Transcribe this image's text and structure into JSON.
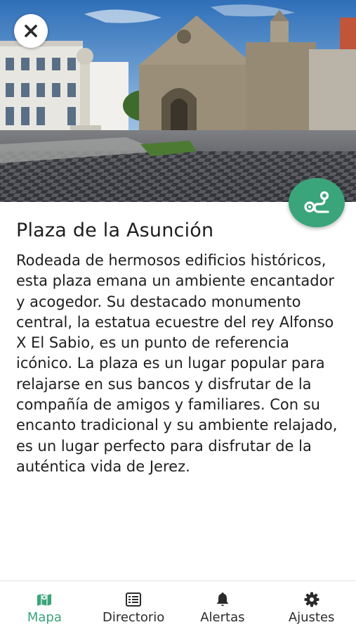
{
  "place": {
    "title": "Plaza de la Asunción",
    "description": "Rodeada de hermosos edificios históricos, esta plaza emana un ambiente encantador y acogedor. Su destacado monumento central, la estatua ecuestre del rey Alfonso X El Sabio, es un punto de referencia icónico. La plaza es un lugar popular para relajarse en sus bancos y disfrutar de la compañía de amigos y familiares. Con su encanto tradicional y su ambiente relajado, es un lugar perfecto para disfrutar de la auténtica vida de Jerez."
  },
  "buttons": {
    "close_icon": "close-icon",
    "route_icon": "route-icon"
  },
  "nav": {
    "items": [
      {
        "label": "Mapa",
        "icon": "map-icon",
        "active": true
      },
      {
        "label": "Directorio",
        "icon": "list-icon",
        "active": false
      },
      {
        "label": "Alertas",
        "icon": "bell-icon",
        "active": false
      },
      {
        "label": "Ajustes",
        "icon": "gear-icon",
        "active": false
      }
    ]
  },
  "colors": {
    "accent": "#3aa57a",
    "text": "#1e1e1e",
    "nav_inactive": "#2b2b2b"
  }
}
